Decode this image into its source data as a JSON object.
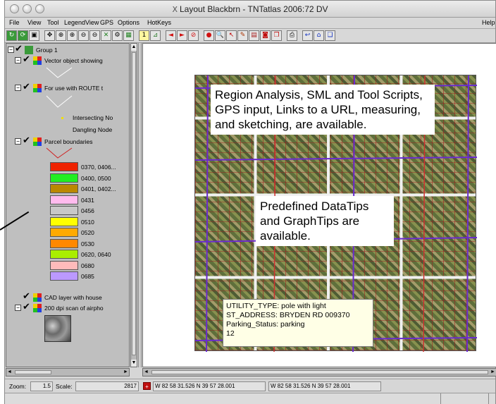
{
  "window": {
    "title": "Layout Blackbrn - TNTatlas 2006:72 DV"
  },
  "menu": [
    "File",
    "View",
    "Tool",
    "LegendView",
    "GPS",
    "Options",
    "HotKeys"
  ],
  "menu_right": "Help",
  "legend": {
    "group": "Group 1",
    "layers": [
      {
        "label": "Vector object showing"
      },
      {
        "label": "For use with ROUTE t"
      },
      {
        "label": "Intersecting No"
      },
      {
        "label": "Dangling Node"
      },
      {
        "label": "Parcel boundaries"
      },
      {
        "label": "CAD layer with house"
      },
      {
        "label": "200 dpi scan of airpho"
      }
    ],
    "classes": [
      {
        "label": "0370, 0406...",
        "color": "#ee2200"
      },
      {
        "label": "0400, 0500",
        "color": "#22ee22"
      },
      {
        "label": "0401, 0402...",
        "color": "#bb8800"
      },
      {
        "label": "0431",
        "color": "#ffbbee"
      },
      {
        "label": "0456",
        "color": "#c8c8c8"
      },
      {
        "label": "0510",
        "color": "#ffff00"
      },
      {
        "label": "0520",
        "color": "#ffaa00"
      },
      {
        "label": "0530",
        "color": "#ff8800"
      },
      {
        "label": "0620, 0640",
        "color": "#aaee00"
      },
      {
        "label": "0680",
        "color": "#ffbbbb"
      },
      {
        "label": "0685",
        "color": "#bb99ff"
      }
    ]
  },
  "map": {
    "callout1": "Region Analysis, SML and Tool Scripts, GPS input, Links to a URL, measuring, and sketching, are available.",
    "callout2": "Predefined DataTips and GraphTips are available.",
    "datatip": [
      "UTILITY_TYPE: pole with light",
      "ST_ADDRESS: BRYDEN  RD   009370",
      "Parking_Status: parking",
      "12"
    ]
  },
  "status": {
    "zoom_label": "Zoom:",
    "zoom_value": "1.5",
    "scale_label": "Scale:",
    "scale_value": "2817",
    "coord1": "W 82 58 31.526  N 39 57 28.001",
    "coord2": "W 82 58 31.526  N 39 57 28.001"
  }
}
